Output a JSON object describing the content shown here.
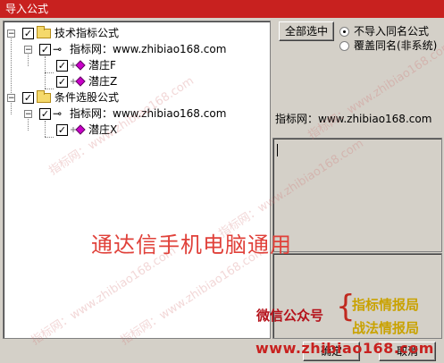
{
  "window": {
    "title": "导入公式"
  },
  "tree": {
    "groups": [
      {
        "label": "技术指标公式",
        "checked": true,
        "source": "指标网：www.zhibiao168.com",
        "items": [
          {
            "label": "潜庄F",
            "checked": true
          },
          {
            "label": "潜庄Z",
            "checked": true
          }
        ]
      },
      {
        "label": "条件选股公式",
        "checked": true,
        "source": "指标网：www.zhibiao168.com",
        "items": [
          {
            "label": "潜庄X",
            "checked": true
          }
        ]
      }
    ]
  },
  "right_panel": {
    "select_all_label": "全部选中",
    "options": [
      {
        "label": "不导入同名公式",
        "selected": true
      },
      {
        "label": "覆盖同名(非系统)",
        "selected": false
      }
    ],
    "source_text": "指标网：www.zhibiao168.com"
  },
  "overlay": {
    "banner": "通达信手机电脑通用",
    "wechat_label": "微信公众号",
    "brace": "{",
    "wechat_1": "指标情报局",
    "wechat_2": "战法情报局",
    "site": "www.zhibiao168.com",
    "watermark": "指标网：www.zhibiao168.com"
  },
  "footer": {
    "ok_label": "确定",
    "cancel_label": "取消"
  },
  "colors": {
    "titlebar": "#c8211f",
    "banner": "#e0413a",
    "wechat_accent": "#c9a200"
  }
}
